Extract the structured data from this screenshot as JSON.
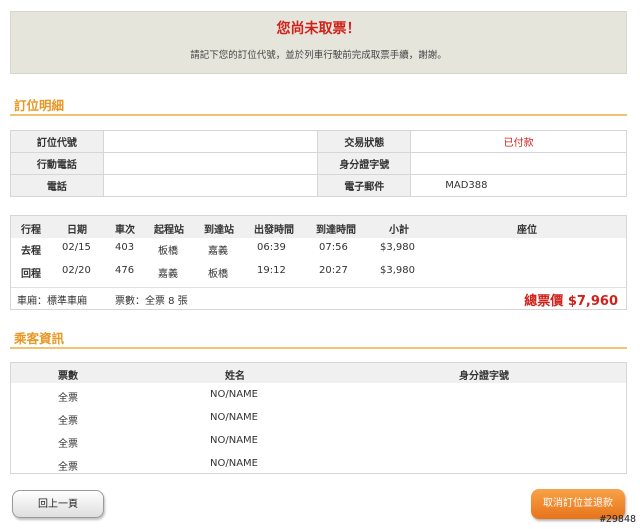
{
  "notice": {
    "title": "您尚未取票！",
    "message": "請記下您的訂位代號，並於列車行駛前完成取票手續，謝謝。"
  },
  "booking": {
    "section_title": "訂位明細",
    "labels": {
      "code": "訂位代號",
      "status": "交易狀態",
      "mobile": "行動電話",
      "id_number": "身分證字號",
      "phone": "電話",
      "email": "電子郵件"
    },
    "values": {
      "code": "",
      "status": "已付款",
      "mobile": "",
      "id_number": "",
      "phone": "",
      "email": "MAD388"
    }
  },
  "trips": {
    "headers": [
      "行程",
      "日期",
      "車次",
      "起程站",
      "到達站",
      "出發時間",
      "到達時間",
      "小計",
      "座位"
    ],
    "rows": [
      [
        "去程",
        "02/15",
        "403",
        "板橋",
        "嘉義",
        "06:39",
        "07:56",
        "$3,980",
        ""
      ],
      [
        "回程",
        "02/20",
        "476",
        "嘉義",
        "板橋",
        "19:12",
        "20:27",
        "$3,980",
        ""
      ]
    ],
    "car_type": "車廂：標準車廂",
    "ticket_count": "票數：全票 8 張",
    "total_label": "總票價",
    "total_value": "$7,960"
  },
  "passengers": {
    "section_title": "乘客資訊",
    "headers": [
      "票數",
      "姓名",
      "身分證字號"
    ],
    "rows": [
      [
        "全票",
        "NO/NAME",
        ""
      ],
      [
        "全票",
        "NO/NAME",
        ""
      ],
      [
        "全票",
        "NO/NAME",
        ""
      ],
      [
        "全票",
        "NO/NAME",
        ""
      ]
    ]
  },
  "buttons": {
    "back": "回上一頁",
    "cancel": "取消訂位並退款"
  },
  "watermark": "#29848",
  "colors": {
    "accent_orange": "#e89722",
    "alert_red": "#d0221b",
    "notice_bg": "#e6e5dc"
  }
}
